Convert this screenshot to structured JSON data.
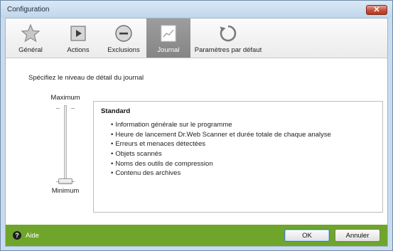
{
  "window": {
    "title": "Configuration",
    "close_label": "✕"
  },
  "tabs": [
    {
      "label": "Général",
      "icon": "star-icon"
    },
    {
      "label": "Actions",
      "icon": "play-icon"
    },
    {
      "label": "Exclusions",
      "icon": "minus-circle-icon"
    },
    {
      "label": "Journal",
      "icon": "journal-chart-icon",
      "active": true
    },
    {
      "label": "Paramètres par défaut",
      "icon": "reset-arrow-icon"
    }
  ],
  "main": {
    "heading": "Spécifiez le niveau de détail du journal"
  },
  "slider": {
    "max_label": "Maximum",
    "min_label": "Minimum",
    "level": 0
  },
  "detail": {
    "title": "Standard",
    "items": [
      "Information générale sur le programme",
      "Heure de lancement Dr.Web Scanner et durée totale de chaque analyse",
      "Erreurs et menaces détectées",
      "Objets scannés",
      "Noms des outils de compression",
      "Contenu des archives"
    ]
  },
  "footer": {
    "help_icon_glyph": "?",
    "help_label": "Aide",
    "ok_label": "OK",
    "cancel_label": "Annuler"
  },
  "colors": {
    "footer_green": "#6fa52b",
    "active_tab": "#8e8e8e",
    "title_bar": "#c9dcef"
  }
}
